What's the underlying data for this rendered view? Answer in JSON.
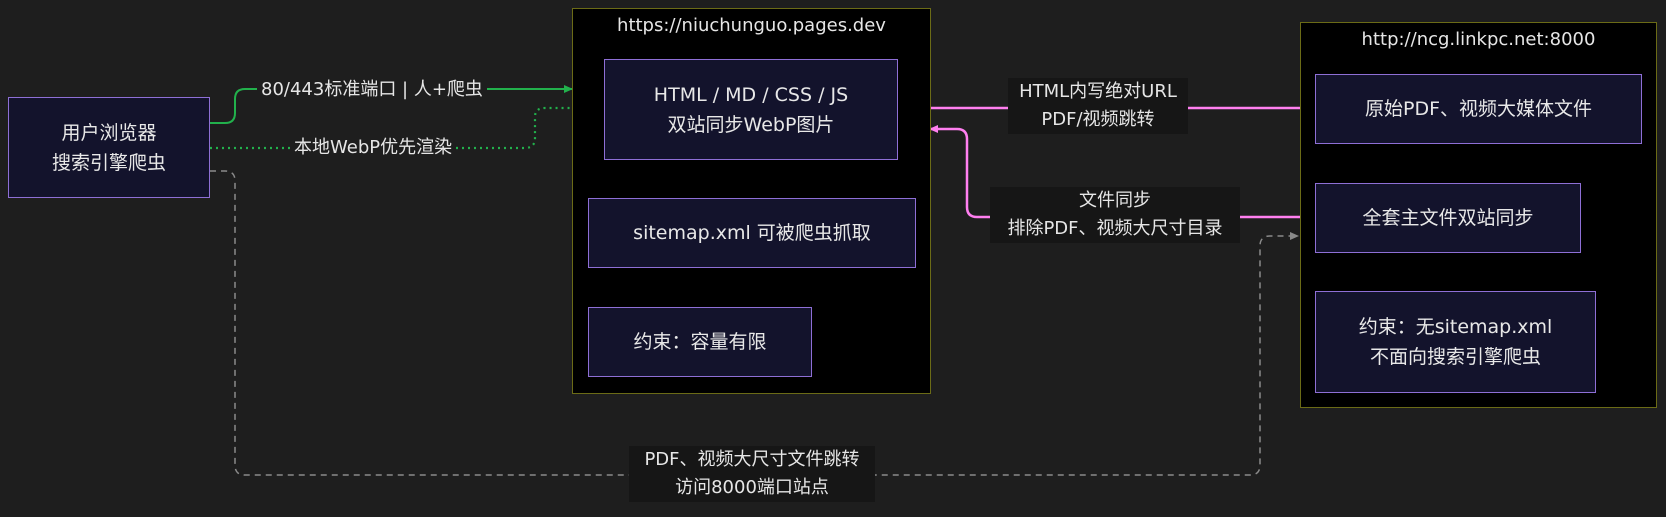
{
  "groups": {
    "pages_site": {
      "title": "https://niuchunguo.pages.dev"
    },
    "linkpc_site": {
      "title": "http://ncg.linkpc.net:8000"
    }
  },
  "nodes": {
    "user": {
      "line1": "用户浏览器",
      "line2": "搜索引擎爬虫"
    },
    "html_assets": {
      "line1": "HTML / MD / CSS / JS",
      "line2": "双站同步WebP图片"
    },
    "sitemap": {
      "line1": "sitemap.xml 可被爬虫抓取"
    },
    "constraint_pages": {
      "line1": "约束：容量有限"
    },
    "original_media": {
      "line1": "原始PDF、视频大媒体文件"
    },
    "full_sync": {
      "line1": "全套主文件双站同步"
    },
    "constraint_linkpc": {
      "line1": "约束：无sitemap.xml",
      "line2": "不面向搜索引擎爬虫"
    }
  },
  "edges": {
    "standard_port": {
      "label": "80/443标准端口 | 人+爬虫",
      "color": "#22b14c"
    },
    "local_webp": {
      "label": "本地WebP优先渲染",
      "color": "#22b14c"
    },
    "absolute_url": {
      "line1": "HTML内写绝对URL",
      "line2": "PDF/视频跳转",
      "color": "#ff7ff0"
    },
    "file_sync": {
      "line1": "文件同步",
      "line2": "排除PDF、视频大尺寸目录",
      "color": "#ff7ff0"
    },
    "large_redirect": {
      "line1": "PDF、视频大尺寸文件跳转",
      "line2": "访问8000端口站点",
      "color": "#8a8a8a"
    },
    "sitemap_arrow": {
      "color": "#4aa3ff"
    }
  }
}
